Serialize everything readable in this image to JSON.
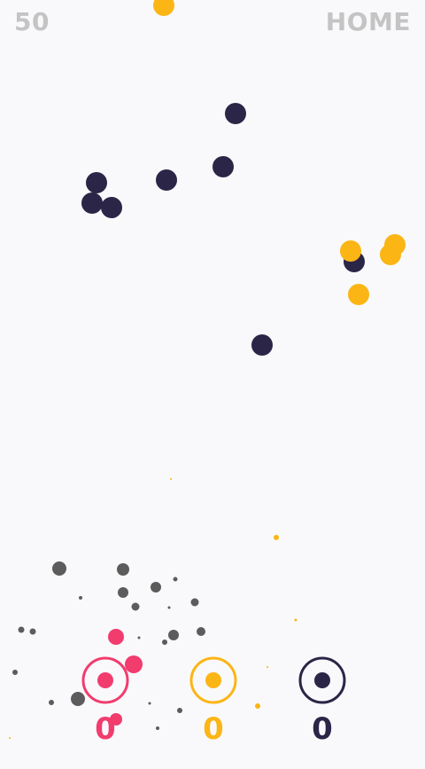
{
  "hud": {
    "score": "50",
    "home_label": "HOME"
  },
  "colors": {
    "pink": "#f23c6e",
    "yellow": "#fbb515",
    "navy": "#2b2547",
    "gray": "#5c5c5c"
  },
  "targets": [
    {
      "name": "pink-target",
      "color": "#f23c6e",
      "count": "0"
    },
    {
      "name": "yellow-target",
      "color": "#fbb515",
      "count": "0"
    },
    {
      "name": "navy-target",
      "color": "#2b2547",
      "count": "0"
    }
  ]
}
